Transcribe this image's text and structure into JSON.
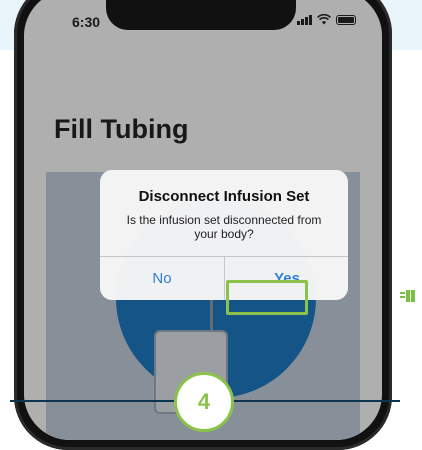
{
  "status_bar": {
    "time": "6:30"
  },
  "screen": {
    "title": "Fill Tubing"
  },
  "alert": {
    "title": "Disconnect Infusion Set",
    "message": "Is the infusion set disconnected from your body?",
    "buttons": {
      "no": "No",
      "yes": "Yes"
    },
    "highlight_color": "#8bc34a"
  },
  "step": {
    "number": "4"
  },
  "colors": {
    "accent_blue": "#2f7fd8",
    "circle_blue": "#1c75bc",
    "step_green": "#8bc34a"
  }
}
